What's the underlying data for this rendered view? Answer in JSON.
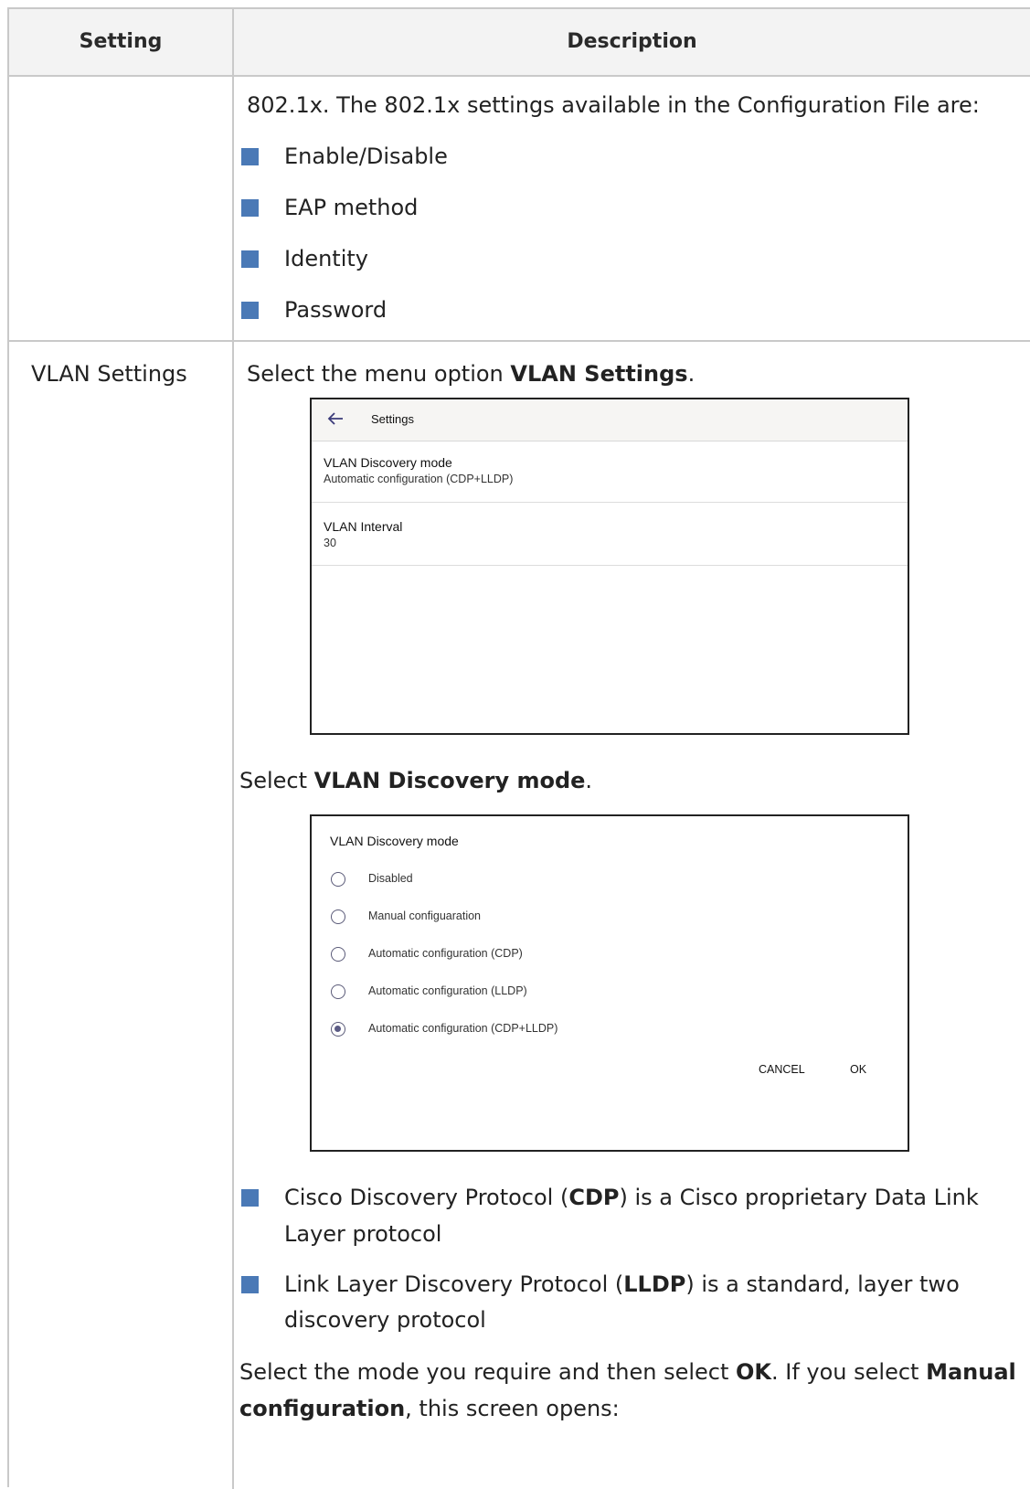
{
  "table": {
    "header": {
      "setting": "Setting",
      "description": "Description"
    },
    "row1": {
      "intro": "802.1x. The 802.1x settings available in the Configuration File are:",
      "bullets": [
        "Enable/Disable",
        "EAP method",
        "Identity",
        "Password"
      ]
    },
    "row2": {
      "setting": "VLAN Settings",
      "step1_pre": "Select the menu option ",
      "step1_bold": "VLAN Settings",
      "step1_post": ".",
      "step2_pre": "Select ",
      "step2_bold": "VLAN Discovery mode",
      "step2_post": ".",
      "bullet1_pre": "Cisco Discovery Protocol (",
      "bullet1_bold": "CDP",
      "bullet1_post": ") is a Cisco proprietary Data Link",
      "bullet1_line2": "Layer protocol",
      "bullet2_pre": "Link Layer Discovery Protocol (",
      "bullet2_bold": "LLDP",
      "bullet2_post": ") is a standard, layer two",
      "bullet2_line2": "discovery protocol",
      "step3_pre": "Select the mode you require and then select ",
      "step3_bold1": "OK",
      "step3_mid": ". If you select ",
      "step3_bold2": "Manual",
      "step3_line2_bold": "configuration",
      "step3_line2_post": ", this screen opens:"
    }
  },
  "settings_screen": {
    "back_icon": "arrow-left-icon",
    "title": "Settings",
    "items": [
      {
        "label": "VLAN Discovery mode",
        "value": "Automatic configuration (CDP+LLDP)"
      },
      {
        "label": "VLAN Interval",
        "value": "30"
      }
    ]
  },
  "discovery_dialog": {
    "title": "VLAN Discovery mode",
    "options": [
      {
        "label": "Disabled",
        "selected": false
      },
      {
        "label": "Manual configuaration",
        "selected": false
      },
      {
        "label": "Automatic configuration (CDP)",
        "selected": false
      },
      {
        "label": "Automatic configuration (LLDP)",
        "selected": false
      },
      {
        "label": "Automatic configuration (CDP+LLDP)",
        "selected": true
      }
    ],
    "cancel_label": "CANCEL",
    "ok_label": "OK"
  },
  "colors": {
    "bullet": "#4a79b6",
    "border": "#c9c9c9",
    "header_bg": "#f3f3f3",
    "radio": "#5b5b84"
  }
}
